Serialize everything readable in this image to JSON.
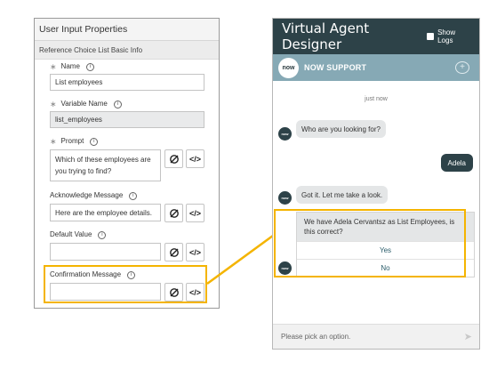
{
  "properties": {
    "title": "User Input Properties",
    "subtitle": "Reference Choice List Basic Info",
    "required_marker": "∗",
    "info_glyph": "i",
    "fields": {
      "name": {
        "label": "Name",
        "value": "List employees"
      },
      "variable_name": {
        "label": "Variable Name",
        "value": "list_employees"
      },
      "prompt": {
        "label": "Prompt",
        "value": "Which of these employees are you trying to find?"
      },
      "acknowledge": {
        "label": "Acknowledge Message",
        "value": "Here are the employee details."
      },
      "default_value": {
        "label": "Default Value",
        "value": ""
      },
      "confirmation": {
        "label": "Confirmation Message",
        "value": ""
      }
    },
    "script_button_icon": "script-pill-icon",
    "code_button_label": "</>"
  },
  "chat": {
    "header_title": "Virtual Agent Designer",
    "show_logs_label": "Show Logs",
    "brand_logo_text": "now",
    "brand_name": "NOW SUPPORT",
    "timestamp": "just now",
    "avatar_text": "now",
    "messages": [
      {
        "from": "bot",
        "text": "Who are you looking for?"
      },
      {
        "from": "user",
        "text": "Adela"
      },
      {
        "from": "bot",
        "text": "Got it. Let me take a look."
      }
    ],
    "confirm_question": "We have Adela Cervantsz as List Employees, is this correct?",
    "options": [
      "Yes",
      "No"
    ],
    "input_placeholder": "Please pick an option."
  },
  "colors": {
    "highlight": "#f4b400",
    "header_bg": "#2d4248",
    "brand_bar_bg": "#86a9b5"
  }
}
